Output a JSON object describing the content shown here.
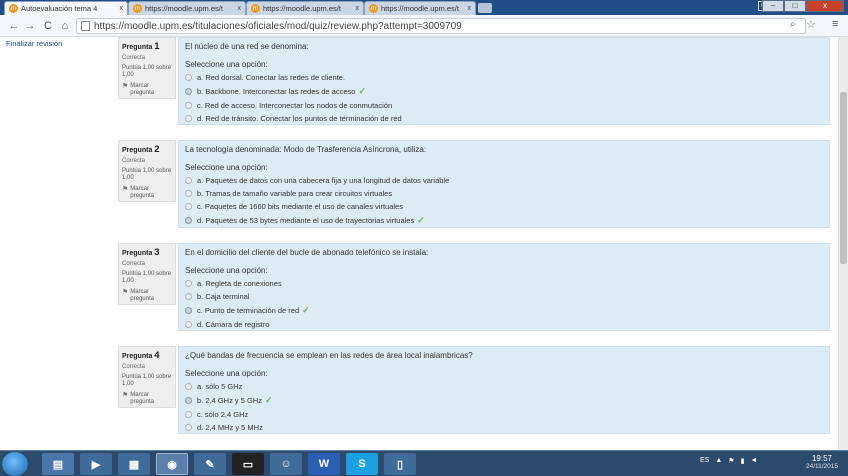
{
  "browser": {
    "tabs": [
      {
        "label": "Autoevaluación tema 4",
        "active": true
      },
      {
        "label": "https://moodle.upm.es/t",
        "active": false
      },
      {
        "label": "https://moodle.upm.es/t",
        "active": false
      },
      {
        "label": "https://moodle.upm.es/t",
        "active": false
      }
    ],
    "tab_close": "x",
    "user_label": "user",
    "window_buttons": {
      "minimize": "–",
      "maximize": "□",
      "close": "x"
    },
    "nav": {
      "back": "←",
      "forward": "→",
      "reload": "C",
      "home": "⌂"
    },
    "url": "https://moodle.upm.es/titulaciones/oficiales/mod/quiz/review.php?attempt=3009709",
    "icons": {
      "zoom": "⌕",
      "star": "☆",
      "menu": "≡"
    }
  },
  "sidebar": {
    "finish_review": "Finalizar revisión"
  },
  "questions": [
    {
      "label": "Pregunta",
      "number": "1",
      "state": "Correcta",
      "grade": "Puntúa 1,00 sobre 1,00",
      "flag": "Marcar pregunta",
      "text": "El núcleo de una red se denomina:",
      "prompt": "Seleccione una opción:",
      "options": [
        {
          "text": "a. Red dorsal. Conectar las redes de cliente.",
          "selected": false,
          "correct": false
        },
        {
          "text": "b. Backbone. Interconectar las redes de acceso",
          "selected": true,
          "correct": true
        },
        {
          "text": "c. Red de acceso. Interconectar los nodos de conmutación",
          "selected": false,
          "correct": false
        },
        {
          "text": "d. Red de tránsito. Conectar los puntos de terminación de red",
          "selected": false,
          "correct": false
        }
      ]
    },
    {
      "label": "Pregunta",
      "number": "2",
      "state": "Correcta",
      "grade": "Puntúa 1,00 sobre 1,00",
      "flag": "Marcar pregunta",
      "text": "La tecnología denominada: Modo de Trasferencia Asíncrona, utiliza:",
      "prompt": "Seleccione una opción:",
      "options": [
        {
          "text": "a. Paquetes de datos con una cabecera fija y una longitud de datos variable",
          "selected": false,
          "correct": false
        },
        {
          "text": "b. Tramas de tamaño variable para crear circuitos virtuales",
          "selected": false,
          "correct": false
        },
        {
          "text": "c. Paquetes de 1660 bits mediante el uso de canales virtuales",
          "selected": false,
          "correct": false
        },
        {
          "text": "d. Paquetes de 53 bytes mediante el uso de trayectorias virtuales",
          "selected": true,
          "correct": true
        }
      ]
    },
    {
      "label": "Pregunta",
      "number": "3",
      "state": "Correcta",
      "grade": "Puntúa 1,00 sobre 1,00",
      "flag": "Marcar pregunta",
      "text": "En el domicilio del cliente del bucle de abonado telefónico se instala:",
      "prompt": "Seleccione una opción:",
      "options": [
        {
          "text": "a. Regleta de conexiones",
          "selected": false,
          "correct": false
        },
        {
          "text": "b. Caja terminal",
          "selected": false,
          "correct": false
        },
        {
          "text": "c. Punto de terminación de red",
          "selected": true,
          "correct": true
        },
        {
          "text": "d. Cámara de registro",
          "selected": false,
          "correct": false
        }
      ]
    },
    {
      "label": "Pregunta",
      "number": "4",
      "state": "Correcta",
      "grade": "Puntúa 1,00 sobre 1,00",
      "flag": "Marcar pregunta",
      "text": "¿Qué bandas de frecuencia se emplean en las redes de área local inalambricas?",
      "prompt": "Seleccione una opción:",
      "options": [
        {
          "text": "a. sólo 5 GHz",
          "selected": false,
          "correct": false
        },
        {
          "text": "b. 2,4 GHz y 5 GHz",
          "selected": true,
          "correct": true
        },
        {
          "text": "c. sólo 2,4 GHz",
          "selected": false,
          "correct": false
        },
        {
          "text": "d. 2,4 MHz y 5 MHz",
          "selected": false,
          "correct": false
        }
      ]
    }
  ],
  "taskbar": {
    "tray_lang": "ES",
    "time": "19:57",
    "date": "24/11/2015"
  },
  "colors": {
    "accent": "#1a4ea8",
    "question_bg": "#dcebf4",
    "correct": "#6ab53e",
    "taskbar": "#2c4a6b"
  }
}
